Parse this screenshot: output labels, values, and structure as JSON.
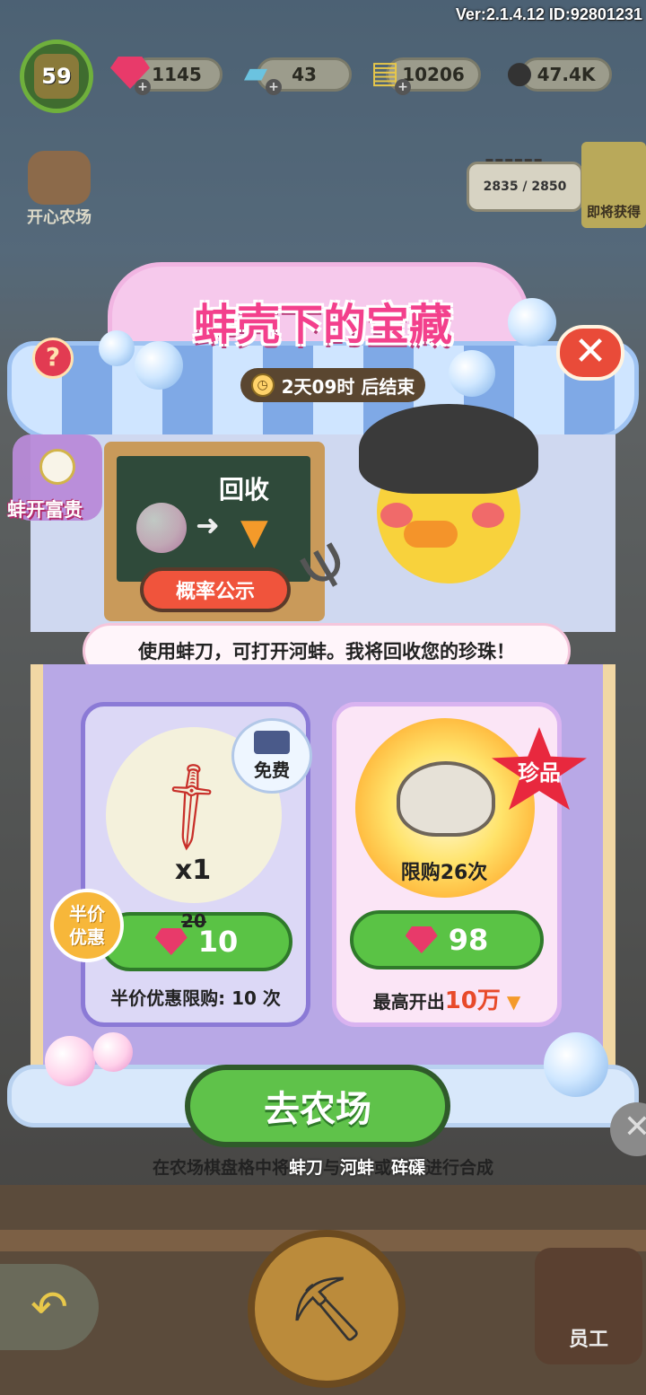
{
  "version": "Ver:2.1.4.12 ID:92801231",
  "player": {
    "level": "59"
  },
  "resources": [
    {
      "icon": "gem-icon",
      "value": "1145"
    },
    {
      "icon": "ticket-icon",
      "value": "43"
    },
    {
      "icon": "coupon-icon",
      "value": "10206"
    },
    {
      "icon": "seed-icon",
      "value": "47.4K"
    }
  ],
  "left_menu": {
    "happy_farm": "开心农场"
  },
  "right_hud": {
    "progress": "2835 / 2850",
    "soon_label": "即将获得"
  },
  "event": {
    "title": "蚌壳下的宝藏",
    "timer": "2天09时 后结束",
    "board_text": "回收",
    "probability_button": "概率公示",
    "speech": "使用蚌刀，可打开河蚌。我将回收您的珍珠！",
    "side_label": "蚌开富贵"
  },
  "left_card": {
    "free_label": "免费",
    "quantity": "x1",
    "half_price_badge_line1": "半价",
    "half_price_badge_line2": "优惠",
    "old_price": "20",
    "price": "10",
    "limit_text": "半价优惠限购: 10 次"
  },
  "right_card": {
    "rare_badge": "珍品",
    "limit": "限购26次",
    "price": "98",
    "max_prefix": "最高开出",
    "max_value": "10万"
  },
  "go_farm_button": "去农场",
  "hint": {
    "prefix": "在农场棋盘格中将",
    "item1": "蚌刀",
    "mid": "与",
    "item2": "河蚌",
    "mid2": "或",
    "item3": "砗磲",
    "suffix": "进行合成"
  },
  "bottom": {
    "staff_label": "员工"
  },
  "colors": {
    "title_pink": "#f3408c",
    "buy_green": "#5ac345",
    "rare_red": "#e8283e",
    "close_red": "#e94b39"
  }
}
